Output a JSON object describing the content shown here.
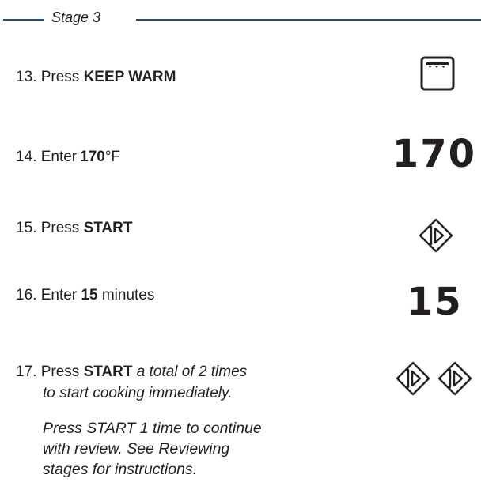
{
  "stage": {
    "title": "Stage 3"
  },
  "steps": {
    "s13": {
      "number": "13.",
      "pre": "Press",
      "bold": "KEEP WARM"
    },
    "s14": {
      "number": "14.",
      "pre": "Enter",
      "bold": "170",
      "post": "°F",
      "display": "170"
    },
    "s15": {
      "number": "15.",
      "pre": "Press",
      "bold": "START"
    },
    "s16": {
      "number": "16.",
      "pre": "Enter",
      "bold": "15",
      "post": "minutes",
      "display": "15"
    },
    "s17": {
      "number": "17.",
      "pre": "Press",
      "bold": "START",
      "italic_line1": "a total of 2 times",
      "italic_line2": "to start cooking immediately."
    }
  },
  "note": {
    "line1": "Press START 1 time to continue",
    "line2": "with review. See Reviewing",
    "line3": "stages for instructions."
  },
  "icons": {
    "keep_warm": "oven-keep-warm-icon",
    "start": "start-diamond-icon"
  }
}
